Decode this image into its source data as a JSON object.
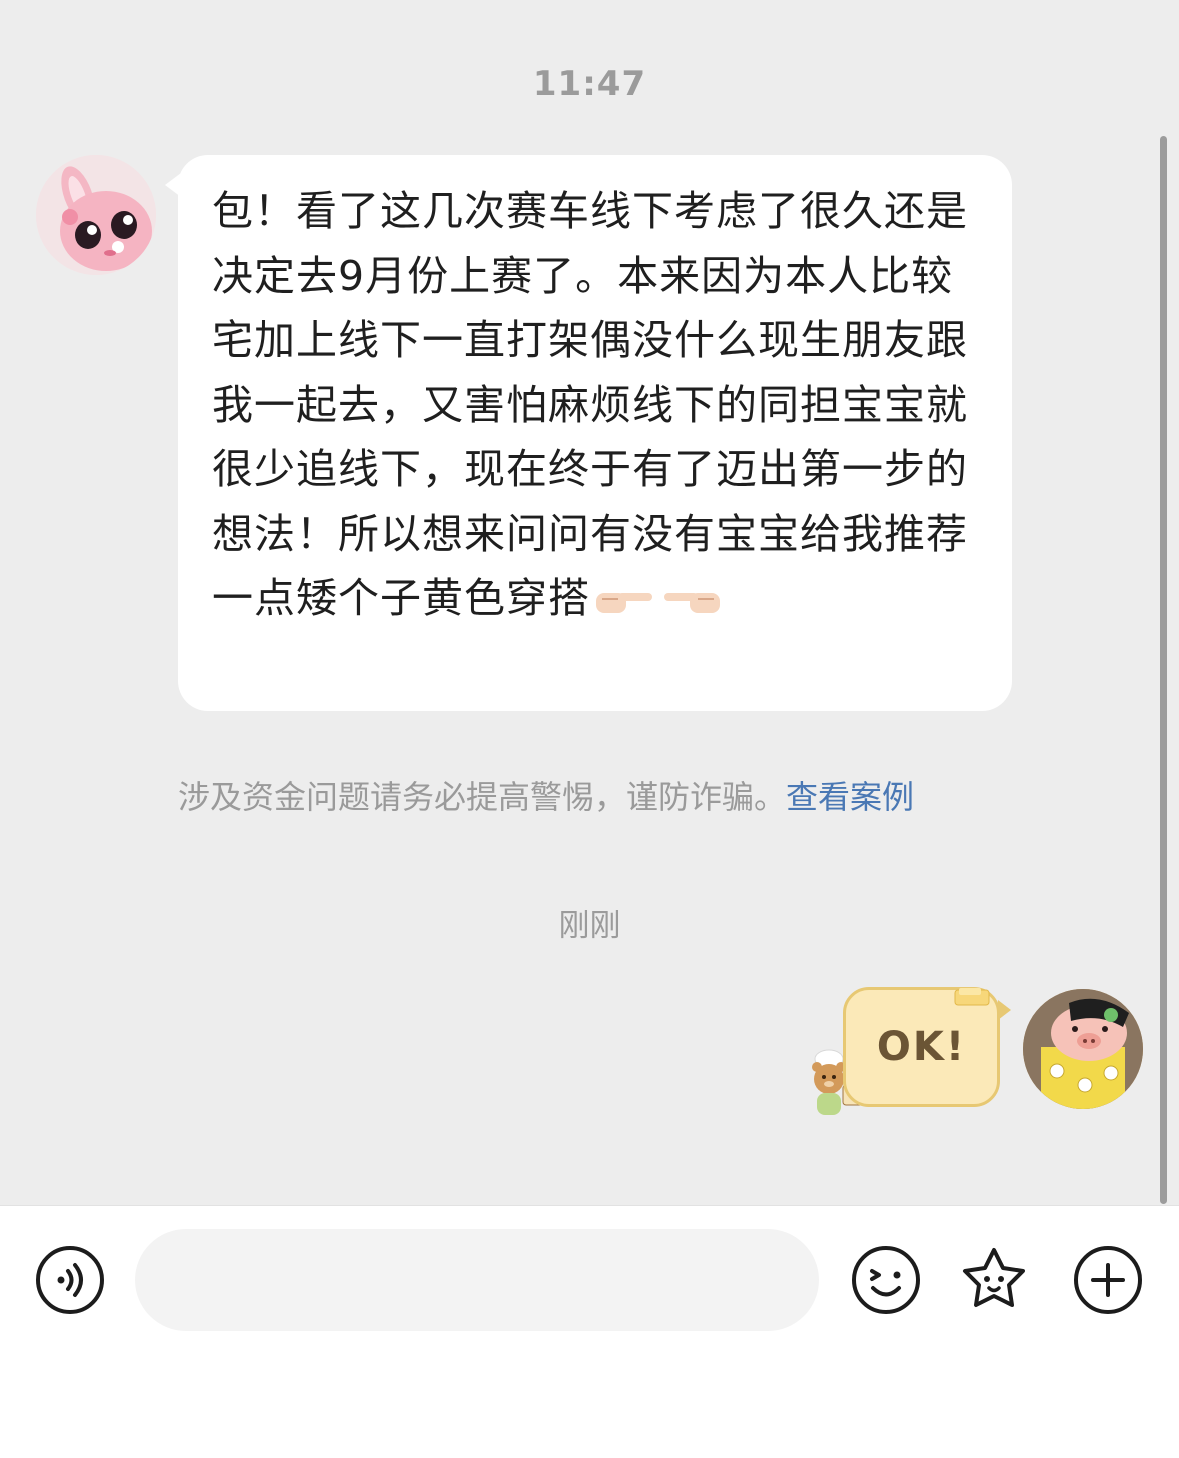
{
  "timestamps": {
    "first": "11:47",
    "second": "刚刚"
  },
  "incoming_message": {
    "text": "包！看了这几次赛车线下考虑了很久还是决定去9月份上赛了。本来因为本人比较宅加上线下一直打架偶没什么现生朋友跟我一起去，又害怕麻烦线下的同担宝宝就很少追线下，现在终于有了迈出第一步的想法！所以想来问问有没有宝宝给我推荐一点矮个子黄色穿搭",
    "emoji": [
      "pointing-right-hand-icon",
      "pointing-left-hand-icon"
    ]
  },
  "warning": {
    "text": "涉及资金问题请务必提高警惕，谨防诈骗。",
    "link": "查看案例"
  },
  "outgoing_message": {
    "text": "OK!"
  },
  "input_bar": {
    "placeholder": "",
    "icons": [
      "voice-icon",
      "emoji-icon",
      "sticker-icon",
      "plus-icon"
    ]
  },
  "colors": {
    "chat_background": "#ededed",
    "incoming_bubble": "#ffffff",
    "outgoing_bubble": "#fbe9b8",
    "link": "#4a78b4"
  }
}
